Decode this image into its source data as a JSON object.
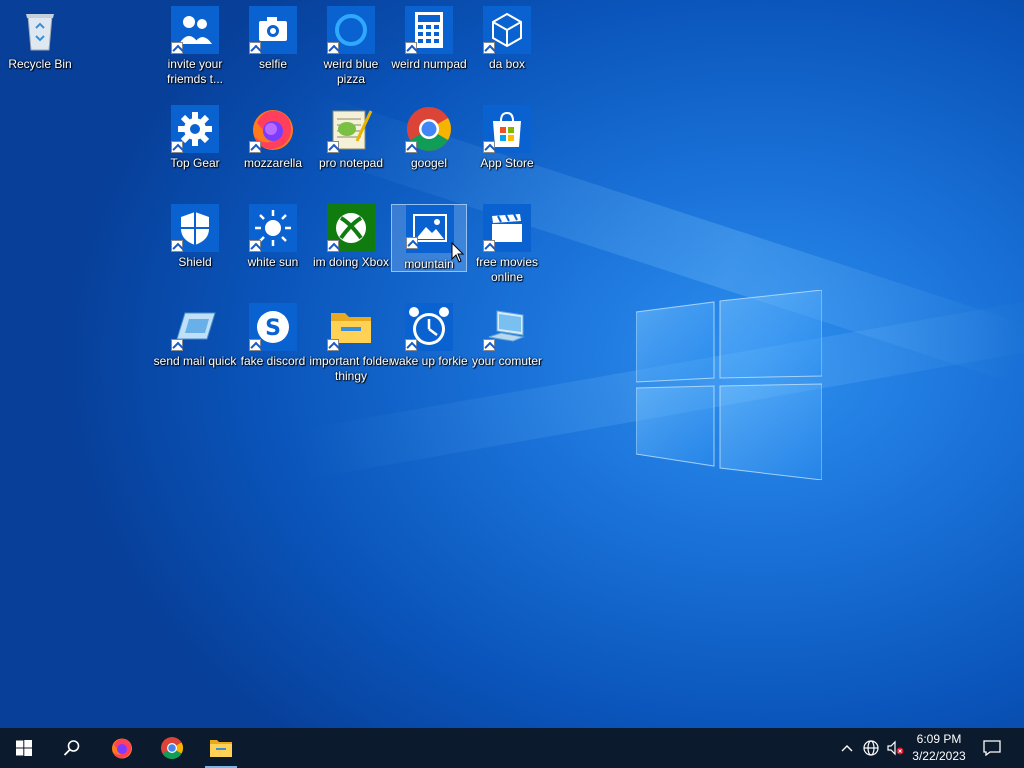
{
  "desktop": {
    "icons": [
      {
        "id": "recycle-bin",
        "label": "Recycle Bin",
        "icon": "recycle-bin-icon",
        "shortcut": false
      },
      {
        "id": "invite",
        "label": "invite your friemds t...",
        "icon": "people-icon",
        "shortcut": true
      },
      {
        "id": "selfie",
        "label": "selfie",
        "icon": "camera-icon",
        "shortcut": true
      },
      {
        "id": "pizza",
        "label": "weird blue pizza",
        "icon": "cortana-ring-icon",
        "shortcut": true
      },
      {
        "id": "numpad",
        "label": "weird numpad",
        "icon": "calculator-icon",
        "shortcut": true
      },
      {
        "id": "dabox",
        "label": "da box",
        "icon": "3d-box-icon",
        "shortcut": true
      },
      {
        "id": "topgear",
        "label": "Top Gear",
        "icon": "gear-icon",
        "shortcut": true
      },
      {
        "id": "mozzarella",
        "label": "mozzarella",
        "icon": "firefox-icon",
        "shortcut": true
      },
      {
        "id": "notepad",
        "label": "pro notepad",
        "icon": "notepad-icon",
        "shortcut": true
      },
      {
        "id": "googel",
        "label": "googel",
        "icon": "chrome-icon",
        "shortcut": true
      },
      {
        "id": "appstore",
        "label": "App Store",
        "icon": "store-bag-icon",
        "shortcut": true
      },
      {
        "id": "shield",
        "label": "Shield",
        "icon": "shield-icon",
        "shortcut": true
      },
      {
        "id": "whitesun",
        "label": "white sun",
        "icon": "sun-icon",
        "shortcut": true
      },
      {
        "id": "xbox",
        "label": "im doing Xbox",
        "icon": "xbox-icon",
        "shortcut": true
      },
      {
        "id": "mountain",
        "label": "mountain",
        "icon": "photos-icon",
        "shortcut": true,
        "selected": true
      },
      {
        "id": "movies",
        "label": "free movies online",
        "icon": "clapperboard-icon",
        "shortcut": true
      },
      {
        "id": "mail",
        "label": "send mail quick",
        "icon": "mail-icon",
        "shortcut": true
      },
      {
        "id": "discord",
        "label": "fake discord",
        "icon": "skype-icon",
        "shortcut": true
      },
      {
        "id": "folder",
        "label": "important folder thingy",
        "icon": "folder-icon",
        "shortcut": true
      },
      {
        "id": "alarm",
        "label": "wake up forkie",
        "icon": "alarm-clock-icon",
        "shortcut": true
      },
      {
        "id": "computer",
        "label": "your comuter",
        "icon": "computer-icon",
        "shortcut": true
      }
    ]
  },
  "taskbar": {
    "start": "windows-start-icon",
    "search": "search-icon",
    "pinned": [
      "firefox-icon",
      "chrome-icon",
      "file-explorer-icon"
    ],
    "tray": [
      "chevron-up-icon",
      "network-globe-icon",
      "speaker-muted-icon"
    ],
    "time": "6:09 PM",
    "date": "3/22/2023",
    "notifications": "action-center-icon"
  }
}
